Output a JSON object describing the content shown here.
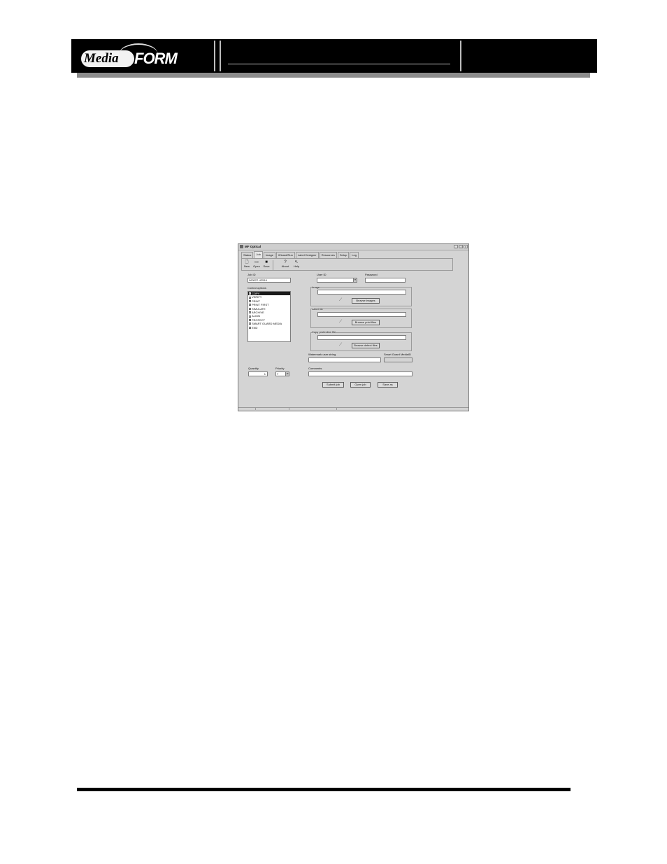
{
  "header": {
    "logo_text_media": "Media",
    "logo_text_form": "FORM"
  },
  "window": {
    "title": "MF Optical",
    "controls": {
      "minimize": "_",
      "maximize": "□",
      "close": "×"
    },
    "tabs": [
      "Status",
      "Job",
      "Image",
      "Wizard/Run",
      "Label Designer",
      "Resources",
      "Setup",
      "Log"
    ],
    "active_tab": "Job",
    "toolbar": {
      "new": "New",
      "open": "Open",
      "save": "Save",
      "about": "About",
      "help": "Help"
    },
    "form": {
      "job_id_label": "Job ID",
      "job_id_value": "063027-42516",
      "user_id_label": "User ID",
      "password_label": "Password",
      "control_options_label": "Control options",
      "control_options": [
        {
          "label": "COPY",
          "checked": true,
          "selected": true
        },
        {
          "label": "VERIFY",
          "checked": false,
          "selected": false
        },
        {
          "label": "PRINT",
          "checked": false,
          "selected": false
        },
        {
          "label": "PRINT FIRST",
          "checked": false,
          "selected": false
        },
        {
          "label": "SIMULATE",
          "checked": false,
          "selected": false
        },
        {
          "label": "ARCHIVE",
          "checked": false,
          "selected": false
        },
        {
          "label": "ALIGN",
          "checked": false,
          "selected": false
        },
        {
          "label": "PROTECT",
          "checked": false,
          "selected": false
        },
        {
          "label": "SMART GUARD MEDIA",
          "checked": false,
          "selected": false
        },
        {
          "label": "END",
          "checked": false,
          "selected": false
        }
      ],
      "image_label": "Image",
      "browse_images": "Browse images",
      "label_file_label": "Label file",
      "browse_print_files": "Browse print files",
      "copy_protection_label": "Copy protection file",
      "browse_defect_files": "Browse defect files",
      "watermark_label": "Watermark user string",
      "smart_guard_label": "Smart Guard MediaID",
      "quantity_label": "Quantity",
      "quantity_value": "1",
      "priority_label": "Priority",
      "priority_value": "7",
      "comments_label": "Comments",
      "submit_job": "Submit job",
      "open_job": "Open job",
      "save_as": "Save as"
    }
  }
}
